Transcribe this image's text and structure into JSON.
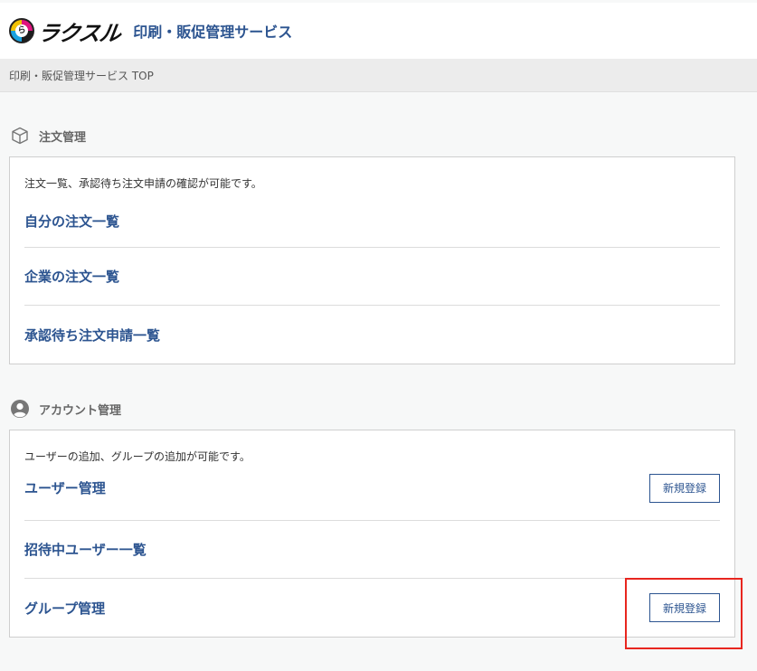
{
  "header": {
    "logo_text": "ラクスル",
    "service_title": "印刷・販促管理サービス"
  },
  "breadcrumb": "印刷・販促管理サービス TOP",
  "orders": {
    "section_label": "注文管理",
    "icon": "box-icon",
    "description": "注文一覧、承認待ち注文申請の確認が可能です。",
    "links": [
      "自分の注文一覧",
      "企業の注文一覧",
      "承認待ち注文申請一覧"
    ]
  },
  "accounts": {
    "section_label": "アカウント管理",
    "icon": "user-circle-icon",
    "description": "ユーザーの追加、グループの追加が可能です。",
    "links": [
      "ユーザー管理",
      "招待中ユーザー一覧",
      "グループ管理"
    ],
    "new_button_label": "新規登録"
  },
  "colors": {
    "accent": "#2c5490",
    "highlight": "#e8261f"
  }
}
